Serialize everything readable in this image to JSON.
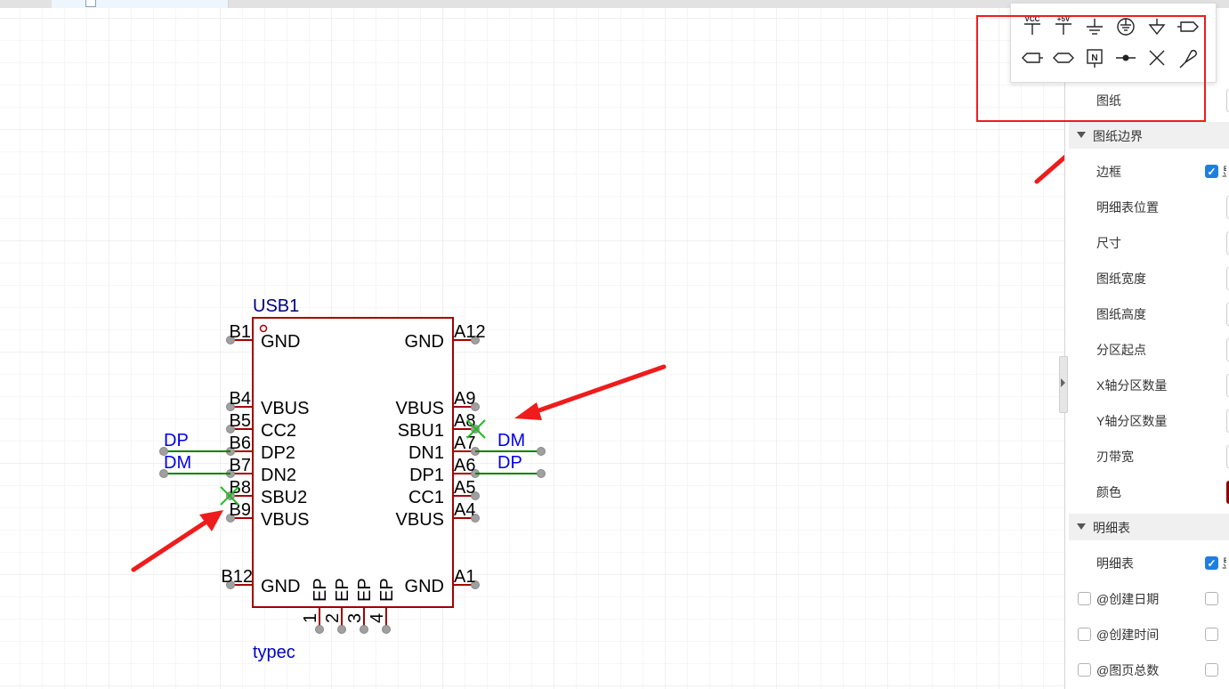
{
  "component": {
    "designator": "USB1",
    "value": "typec",
    "left_pins": [
      {
        "num": "B1",
        "name": "GND"
      },
      {
        "num": "B4",
        "name": "VBUS"
      },
      {
        "num": "B5",
        "name": "CC2"
      },
      {
        "num": "B6",
        "name": "DP2"
      },
      {
        "num": "B7",
        "name": "DN2"
      },
      {
        "num": "B8",
        "name": "SBU2"
      },
      {
        "num": "B9",
        "name": "VBUS"
      },
      {
        "num": "B12",
        "name": "GND"
      }
    ],
    "right_pins": [
      {
        "num": "A12",
        "name": "GND"
      },
      {
        "num": "A9",
        "name": "VBUS"
      },
      {
        "num": "A8",
        "name": "SBU1"
      },
      {
        "num": "A7",
        "name": "DN1"
      },
      {
        "num": "A6",
        "name": "DP1"
      },
      {
        "num": "A5",
        "name": "CC1"
      },
      {
        "num": "A4",
        "name": "VBUS"
      },
      {
        "num": "A1",
        "name": "GND"
      }
    ],
    "bottom_pins": [
      {
        "num": "1",
        "name": "EP"
      },
      {
        "num": "2",
        "name": "EP"
      },
      {
        "num": "3",
        "name": "EP"
      },
      {
        "num": "4",
        "name": "EP"
      }
    ]
  },
  "net_labels": {
    "left_dp": "DP",
    "left_dm": "DM",
    "right_dm": "DM",
    "right_dp": "DP"
  },
  "colors": {
    "body": "#a50000",
    "pin_name": "#000000",
    "designator": "#000080",
    "value": "#0000c8",
    "net_label": "#0000ee",
    "wire": "#008000",
    "no_connect": "#22bb22",
    "annotation": "#ee1c1c"
  },
  "toolbar": {
    "vcc_text": "VCC",
    "plus5v_text": "+5V",
    "netport_text": "N",
    "icons": [
      "vcc-icon",
      "plus-5v-icon",
      "ground-icon",
      "earth-ground-icon",
      "signal-ground-icon",
      "net-port-out-icon",
      "net-port-in-icon",
      "net-port-bidir-icon",
      "net-flag-icon",
      "net-label-dot-icon",
      "no-connect-icon",
      "probe-icon"
    ]
  },
  "panel": {
    "top_field_label": "图纸",
    "section_border": "图纸边界",
    "border_label": "边框",
    "border_checked": true,
    "border_checkbox_text": "显",
    "rows": [
      "明细表位置",
      "尺寸",
      "图纸宽度",
      "图纸高度",
      "分区起点",
      "X轴分区数量",
      "Y轴分区数量",
      "刃带宽",
      "颜色"
    ],
    "section_table": "明细表",
    "table_label": "明细表",
    "table_checked": true,
    "table_checkbox_text": "显",
    "check_rows": [
      {
        "label": "@创建日期",
        "checked": false
      },
      {
        "label": "@创建时间",
        "checked": false
      },
      {
        "label": "@图页总数",
        "checked": false
      }
    ]
  }
}
